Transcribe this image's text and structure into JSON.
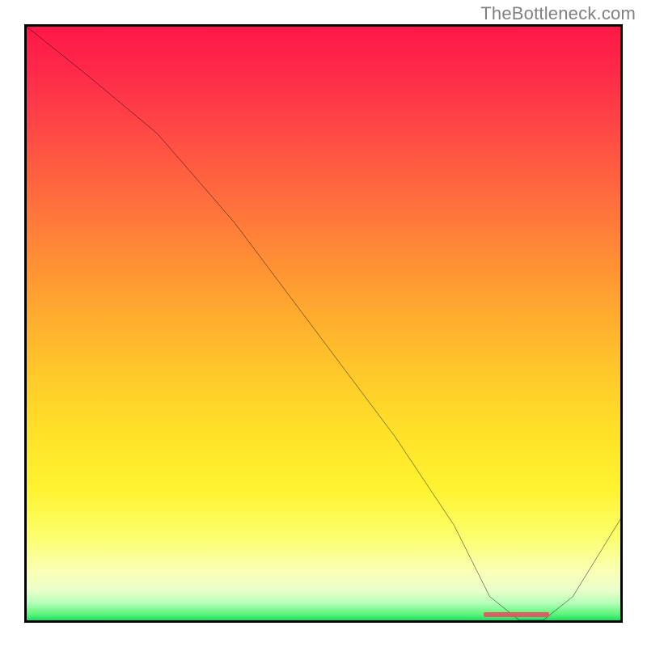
{
  "watermark": "TheBottleneck.com",
  "chart_data": {
    "type": "line",
    "title": "",
    "xlabel": "",
    "ylabel": "",
    "xlim": [
      0,
      100
    ],
    "ylim": [
      0,
      100
    ],
    "grid": false,
    "series": [
      {
        "name": "curve",
        "x": [
          0,
          10,
          22,
          35,
          50,
          62,
          72,
          78,
          83,
          87,
          92,
          100
        ],
        "y": [
          100,
          92,
          82,
          67,
          47,
          31,
          16,
          4,
          0,
          0,
          4,
          17
        ]
      }
    ],
    "annotations": [
      {
        "name": "floor-marker",
        "x_start": 77,
        "x_end": 88,
        "y": 0
      }
    ],
    "background": {
      "type": "vertical-gradient",
      "stops": [
        {
          "pos": 0,
          "color": "#ff1846"
        },
        {
          "pos": 50,
          "color": "#ffaa2f"
        },
        {
          "pos": 80,
          "color": "#fff330"
        },
        {
          "pos": 100,
          "color": "#19e062"
        }
      ]
    }
  }
}
